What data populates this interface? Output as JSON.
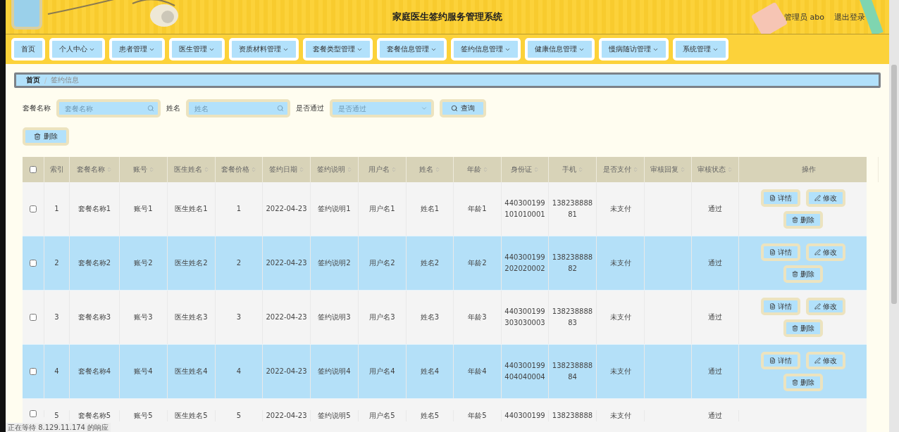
{
  "header": {
    "title": "家庭医生签约服务管理系统",
    "user": "管理员 abo",
    "logout": "退出登录"
  },
  "nav": [
    {
      "label": "首页",
      "dropdown": false
    },
    {
      "label": "个人中心",
      "dropdown": true
    },
    {
      "label": "患者管理",
      "dropdown": true
    },
    {
      "label": "医生管理",
      "dropdown": true
    },
    {
      "label": "资质材料管理",
      "dropdown": true
    },
    {
      "label": "套餐类型管理",
      "dropdown": true
    },
    {
      "label": "套餐信息管理",
      "dropdown": true
    },
    {
      "label": "签约信息管理",
      "dropdown": true
    },
    {
      "label": "健康信息管理",
      "dropdown": true
    },
    {
      "label": "慢病随访管理",
      "dropdown": true
    },
    {
      "label": "系统管理",
      "dropdown": true
    }
  ],
  "breadcrumb": [
    "首页",
    "签约信息"
  ],
  "breadcrumb_separator": "/",
  "search": {
    "fields": [
      {
        "kind": "text",
        "label": "套餐名称",
        "placeholder": "套餐名称"
      },
      {
        "kind": "text",
        "label": "姓名",
        "placeholder": "姓名"
      },
      {
        "kind": "select",
        "label": "是否通过",
        "placeholder": "是否通过"
      }
    ],
    "button": "查询"
  },
  "delete_button": "删除",
  "table": {
    "header_checked": false,
    "columns": [
      {
        "label": "索引",
        "sortable": false
      },
      {
        "label": "套餐名称",
        "sortable": true
      },
      {
        "label": "账号",
        "sortable": true
      },
      {
        "label": "医生姓名",
        "sortable": true
      },
      {
        "label": "套餐价格",
        "sortable": true
      },
      {
        "label": "签约日期",
        "sortable": true
      },
      {
        "label": "签约说明",
        "sortable": true
      },
      {
        "label": "用户名",
        "sortable": true
      },
      {
        "label": "姓名",
        "sortable": true
      },
      {
        "label": "年龄",
        "sortable": true
      },
      {
        "label": "身份证",
        "sortable": true
      },
      {
        "label": "手机",
        "sortable": true
      },
      {
        "label": "是否支付",
        "sortable": true
      },
      {
        "label": "审核回复",
        "sortable": true
      },
      {
        "label": "审核状态",
        "sortable": true
      },
      {
        "label": "操作",
        "sortable": false
      }
    ],
    "rows": [
      {
        "checked": false,
        "cells": [
          "1",
          "套餐名称1",
          "账号1",
          "医生姓名1",
          "1",
          "2022-04-23",
          "签约说明1",
          "用户名1",
          "姓名1",
          "年龄1",
          "440300199\n101010001",
          "138238888\n81",
          "未支付",
          "",
          "通过"
        ],
        "actions": [
          {
            "kind": "detail",
            "label": "详情"
          },
          {
            "kind": "edit",
            "label": "修改"
          },
          {
            "kind": "delete",
            "label": "删除"
          }
        ]
      },
      {
        "checked": false,
        "cells": [
          "2",
          "套餐名称2",
          "账号2",
          "医生姓名2",
          "2",
          "2022-04-23",
          "签约说明2",
          "用户名2",
          "姓名2",
          "年龄2",
          "440300199\n202020002",
          "138238888\n82",
          "未支付",
          "",
          "通过"
        ],
        "actions": [
          {
            "kind": "detail",
            "label": "详情"
          },
          {
            "kind": "edit",
            "label": "修改"
          },
          {
            "kind": "delete",
            "label": "删除"
          }
        ]
      },
      {
        "checked": false,
        "cells": [
          "3",
          "套餐名称3",
          "账号3",
          "医生姓名3",
          "3",
          "2022-04-23",
          "签约说明3",
          "用户名3",
          "姓名3",
          "年龄3",
          "440300199\n303030003",
          "138238888\n83",
          "未支付",
          "",
          "通过"
        ],
        "actions": [
          {
            "kind": "detail",
            "label": "详情"
          },
          {
            "kind": "edit",
            "label": "修改"
          },
          {
            "kind": "delete",
            "label": "删除"
          }
        ]
      },
      {
        "checked": false,
        "cells": [
          "4",
          "套餐名称4",
          "账号4",
          "医生姓名4",
          "4",
          "2022-04-23",
          "签约说明4",
          "用户名4",
          "姓名4",
          "年龄4",
          "440300199\n404040004",
          "138238888\n84",
          "未支付",
          "",
          "通过"
        ],
        "actions": [
          {
            "kind": "detail",
            "label": "详情"
          },
          {
            "kind": "edit",
            "label": "修改"
          },
          {
            "kind": "delete",
            "label": "删除"
          }
        ]
      },
      {
        "checked": false,
        "cells": [
          "5",
          "套餐名称5",
          "账号5",
          "医生姓名5",
          "5",
          "2022-04-23",
          "签约说明5",
          "用户名5",
          "姓名5",
          "年龄5",
          "440300199",
          "138238888",
          "未支付",
          "",
          "通过"
        ]
      }
    ]
  },
  "status_text": "正在等待 8.129.11.174 的响应"
}
